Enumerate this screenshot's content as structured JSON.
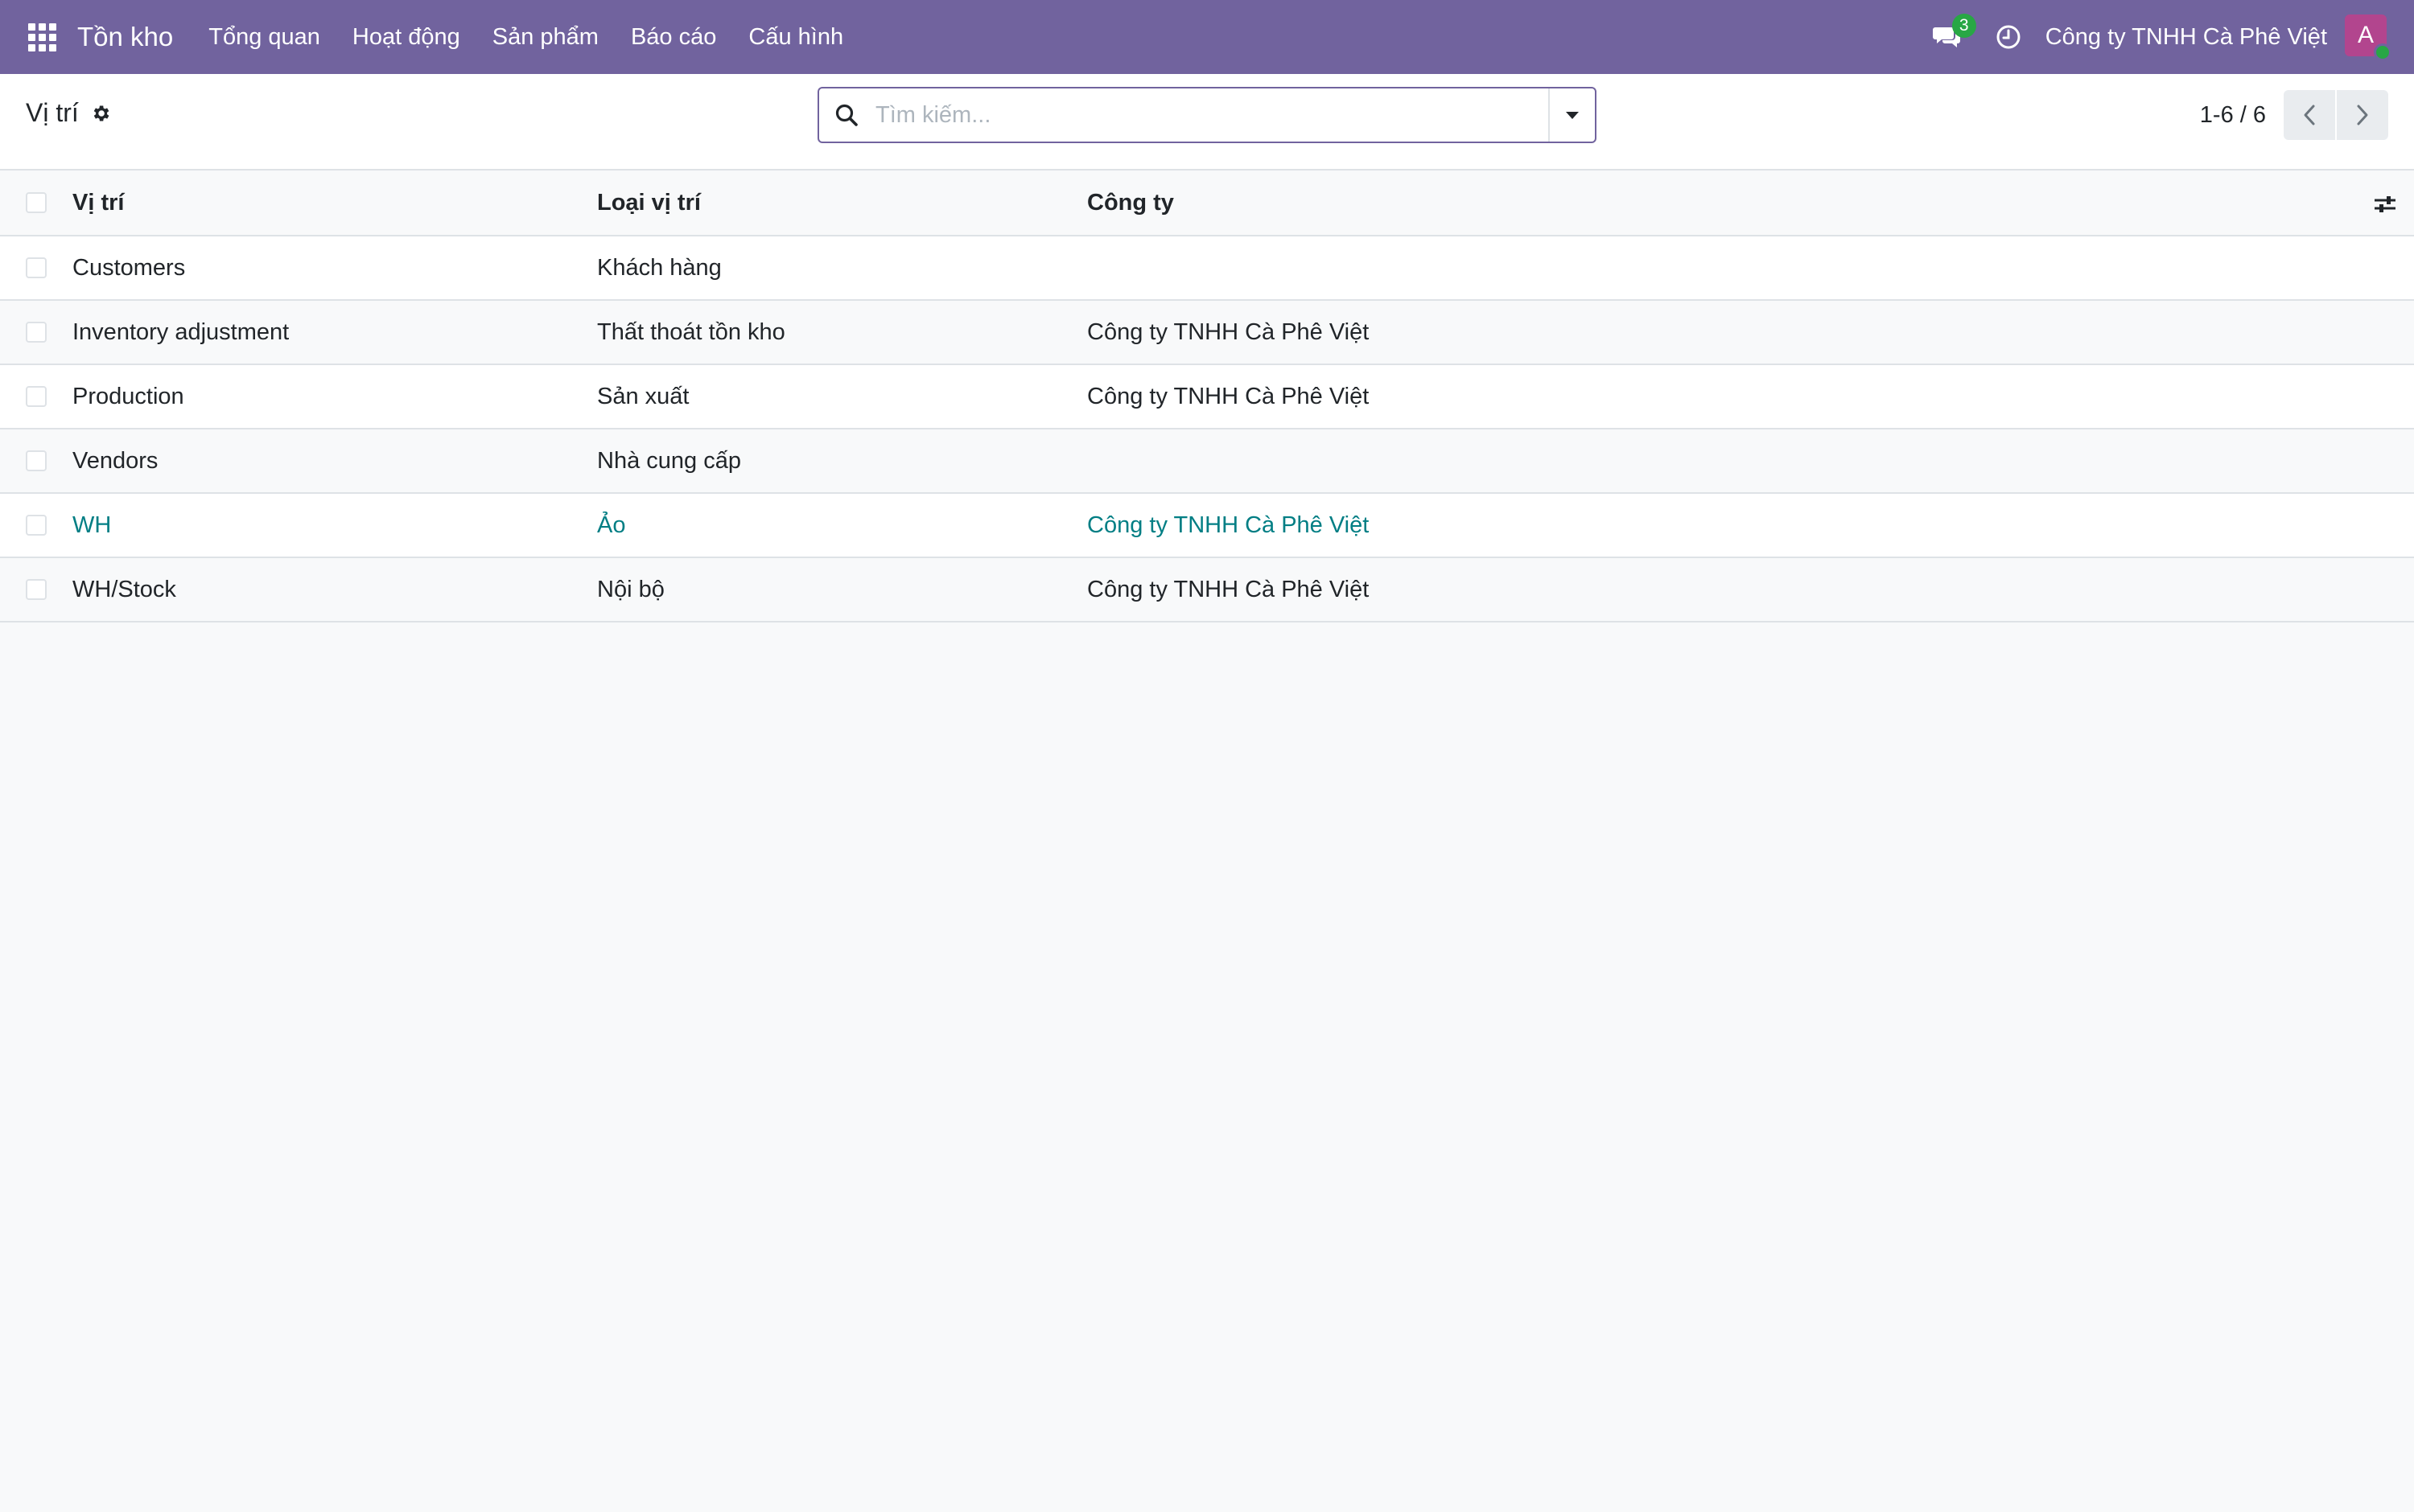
{
  "navbar": {
    "app_name": "Tồn kho",
    "menu": [
      "Tổng quan",
      "Hoạt động",
      "Sản phẩm",
      "Báo cáo",
      "Cấu hình"
    ],
    "messages_count": "3",
    "company": "Công ty TNHH Cà Phê Việt",
    "avatar_initial": "A",
    "color": "#71639e"
  },
  "control_panel": {
    "title": "Vị trí",
    "search_placeholder": "Tìm kiếm...",
    "pager": "1-6 / 6"
  },
  "table": {
    "columns": [
      "Vị trí",
      "Loại vị trí",
      "Công ty"
    ],
    "rows": [
      {
        "name": "Customers",
        "type": "Khách hàng",
        "company": ""
      },
      {
        "name": "Inventory adjustment",
        "type": "Thất thoát tồn kho",
        "company": "Công ty TNHH Cà Phê Việt"
      },
      {
        "name": "Production",
        "type": "Sản xuất",
        "company": "Công ty TNHH Cà Phê Việt"
      },
      {
        "name": "Vendors",
        "type": "Nhà cung cấp",
        "company": ""
      },
      {
        "name": "WH",
        "type": "Ảo",
        "company": "Công ty TNHH Cà Phê Việt"
      },
      {
        "name": "WH/Stock",
        "type": "Nội bộ",
        "company": "Công ty TNHH Cà Phê Việt"
      }
    ],
    "link_color": "#017e84"
  },
  "icons": {
    "apps": "apps-grid-icon",
    "chat": "chat-icon",
    "clock": "clock-icon",
    "gear": "gear-icon",
    "search": "search-icon",
    "toggle": "caret-down-icon",
    "prev": "chevron-left-icon",
    "next": "chevron-right-icon",
    "optional_columns": "sliders-icon"
  }
}
